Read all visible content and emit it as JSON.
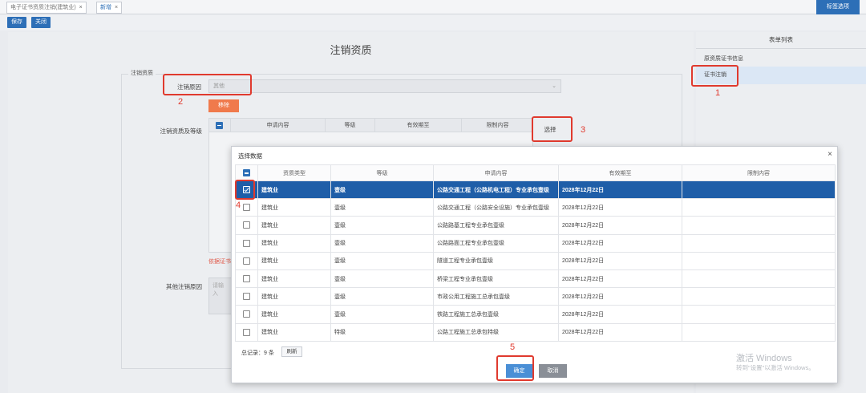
{
  "tabs": [
    {
      "label": "电子证书资质注销(建筑业)",
      "close": "×"
    },
    {
      "label": "新增",
      "close": "×"
    }
  ],
  "top_right_button": "标签选项",
  "toolbar": {
    "save": "保存",
    "close": "关闭"
  },
  "page_title": "注销资质",
  "section_legend": "注销资质",
  "form": {
    "reason_label": "注销原因",
    "reason_value": "其他",
    "remove_button": "移除",
    "quals_label": "注销资质及等级",
    "bg_columns": [
      "申请内容",
      "等级",
      "有效期至",
      "限制内容"
    ],
    "choose_button": "选择",
    "red_text": "依据证书",
    "other_reason_label": "其他注销原因",
    "other_reason_placeholder": "请输入"
  },
  "right_panel": {
    "title": "表单列表",
    "items": [
      "原资质证书信息",
      "证书注销"
    ]
  },
  "annotations": [
    "1",
    "2",
    "3",
    "4",
    "5"
  ],
  "modal": {
    "title": "选择数据",
    "close": "×",
    "columns": [
      "资质类型",
      "等级",
      "申请内容",
      "有效期至",
      "限制内容"
    ],
    "rows": [
      {
        "type": "建筑业",
        "grade": "壹级",
        "content": "公路交通工程（公路机电工程）专业承包壹级",
        "expiry": "2028年12月22日",
        "limit": "",
        "checked": true
      },
      {
        "type": "建筑业",
        "grade": "壹级",
        "content": "公路交通工程（公路安全设施）专业承包壹级",
        "expiry": "2028年12月22日",
        "limit": "",
        "checked": false
      },
      {
        "type": "建筑业",
        "grade": "壹级",
        "content": "公路路基工程专业承包壹级",
        "expiry": "2028年12月22日",
        "limit": "",
        "checked": false
      },
      {
        "type": "建筑业",
        "grade": "壹级",
        "content": "公路路面工程专业承包壹级",
        "expiry": "2028年12月22日",
        "limit": "",
        "checked": false
      },
      {
        "type": "建筑业",
        "grade": "壹级",
        "content": "隧道工程专业承包壹级",
        "expiry": "2028年12月22日",
        "limit": "",
        "checked": false
      },
      {
        "type": "建筑业",
        "grade": "壹级",
        "content": "桥梁工程专业承包壹级",
        "expiry": "2028年12月22日",
        "limit": "",
        "checked": false
      },
      {
        "type": "建筑业",
        "grade": "壹级",
        "content": "市政公用工程施工总承包壹级",
        "expiry": "2028年12月22日",
        "limit": "",
        "checked": false
      },
      {
        "type": "建筑业",
        "grade": "壹级",
        "content": "铁路工程施工总承包壹级",
        "expiry": "2028年12月22日",
        "limit": "",
        "checked": false
      },
      {
        "type": "建筑业",
        "grade": "特级",
        "content": "公路工程施工总承包特级",
        "expiry": "2028年12月22日",
        "limit": "",
        "checked": false
      }
    ],
    "total_text": "总记录：9 条",
    "refresh": "刷新",
    "confirm": "确定",
    "cancel": "取消"
  },
  "watermark": {
    "line1": "激活 Windows",
    "line2": "转到\"设置\"以激活 Windows。"
  }
}
